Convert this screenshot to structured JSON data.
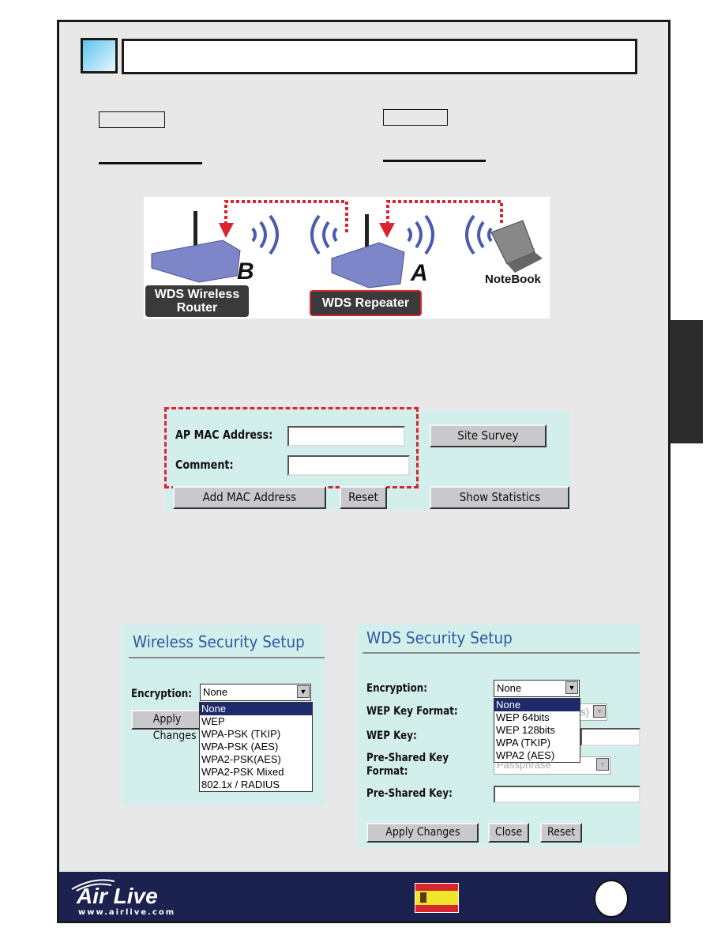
{
  "diagram": {
    "label_b": "B",
    "label_a": "A",
    "router_tag_line1": "WDS Wireless",
    "router_tag_line2": "Router",
    "repeater_tag": "WDS Repeater",
    "notebook_label": "NoteBook"
  },
  "mac_form": {
    "ap_mac_label": "AP MAC Address:",
    "ap_mac_value": "",
    "comment_label": "Comment:",
    "comment_value": "",
    "site_survey": "Site Survey",
    "add_mac": "Add MAC Address",
    "reset": "Reset",
    "show_statistics": "Show Statistics"
  },
  "wireless_security": {
    "title": "Wireless Security Setup",
    "encryption_label": "Encryption:",
    "encryption_value": "None",
    "apply": "Apply Changes",
    "options": [
      "None",
      "WEP",
      "WPA-PSK (TKIP)",
      "WPA-PSK (AES)",
      "WPA2-PSK(AES)",
      "WPA2-PSK Mixed",
      "802.1x / RADIUS"
    ]
  },
  "wds_security": {
    "title": "WDS Security Setup",
    "encryption_label": "Encryption:",
    "encryption_value": "None",
    "wep_key_format_label": "WEP Key Format:",
    "wep_key_format_value": "(s)",
    "wep_key_label": "WEP Key:",
    "psk_format_label_line1": "Pre-Shared Key",
    "psk_format_label_line2": "Format:",
    "psk_format_value": "Passphrase",
    "psk_label": "Pre-Shared Key:",
    "options": [
      "None",
      "WEP 64bits",
      "WEP 128bits",
      "WPA (TKIP)",
      "WPA2 (AES)"
    ],
    "apply": "Apply Changes",
    "close": "Close",
    "reset": "Reset"
  },
  "footer": {
    "logo": "Air Live",
    "url": "www.airlive.com"
  },
  "colors": {
    "footer": "#1c2250",
    "panel": "#d3efec",
    "accent_red": "#d7262e",
    "title_blue": "#2b5aa0"
  }
}
